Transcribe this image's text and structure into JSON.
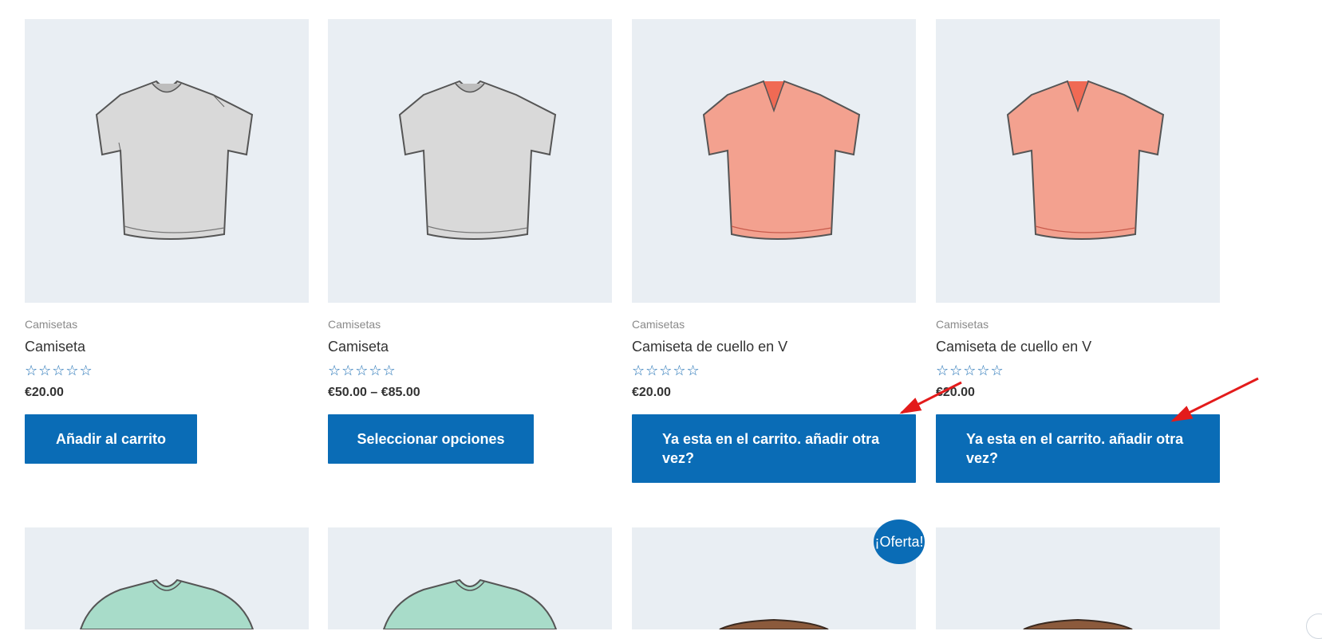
{
  "products": [
    {
      "category": "Camisetas",
      "title": "Camiseta",
      "rating_stars": "☆☆☆☆☆",
      "price": "€20.00",
      "button_label": "Añadir al carrito",
      "shirt_color": "#d9d9d9",
      "neck": "crew"
    },
    {
      "category": "Camisetas",
      "title": "Camiseta",
      "rating_stars": "☆☆☆☆☆",
      "price": "€50.00 – €85.00",
      "button_label": "Seleccionar opciones",
      "shirt_color": "#d9d9d9",
      "neck": "crew"
    },
    {
      "category": "Camisetas",
      "title": "Camiseta de cuello en V",
      "rating_stars": "☆☆☆☆☆",
      "price": "€20.00",
      "button_label": "Ya esta en el carrito. añadir otra vez?",
      "shirt_color": "#f3a18f",
      "neck": "v"
    },
    {
      "category": "Camisetas",
      "title": "Camiseta de cuello en V",
      "rating_stars": "☆☆☆☆☆",
      "price": "€20.00",
      "button_label": "Ya esta en el carrito. añadir otra vez?",
      "shirt_color": "#f3a18f",
      "neck": "v"
    }
  ],
  "second_row": {
    "items": [
      {
        "shirt_color": "#a8dcc9"
      },
      {
        "shirt_color": "#a8dcc9"
      },
      {
        "shirt_color": "#8b5a3c"
      },
      {
        "shirt_color": "#8b5a3c"
      }
    ],
    "sale_badge": "¡Oferta!"
  },
  "colors": {
    "accent": "#0a6cb6",
    "thumb_bg": "#e9eef3",
    "annotation_arrow": "#e31b1b"
  },
  "icons": {
    "rating": "star-outline-icon"
  }
}
